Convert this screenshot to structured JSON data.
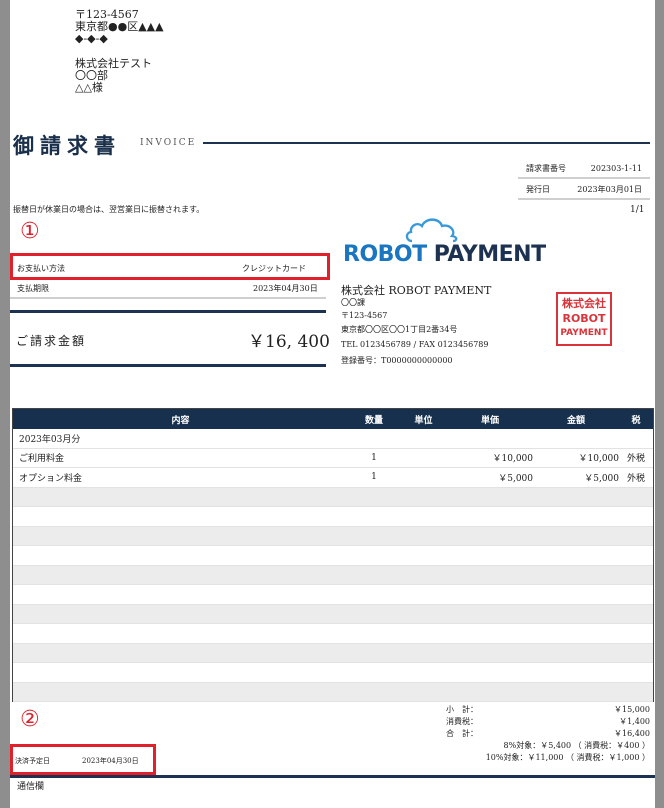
{
  "recipient": {
    "postal": "〒123-4567",
    "address1": "東京都●●区▲▲▲",
    "address2": "◆-◆-◆",
    "company": "株式会社テスト",
    "department": "〇〇部",
    "person": "△△様"
  },
  "header": {
    "title": "御請求書",
    "title_en": "INVOICE"
  },
  "meta": {
    "invoice_no_label": "請求書番号",
    "invoice_no": "202303-1-11",
    "issue_date_label": "発行日",
    "issue_date": "2023年03月01日",
    "page": "1/1"
  },
  "notice": "振替日が休業日の場合は、翌営業日に振替されます。",
  "annotations": {
    "marker1": "①",
    "marker2": "②"
  },
  "payment": {
    "method_label": "お支払い方法",
    "method_value": "クレジットカード",
    "due_label": "支払期限",
    "due_value": "2023年04月30日",
    "amount_label": "ご請求金額",
    "amount_value": "￥16, 400"
  },
  "issuer": {
    "logo_part1": "ROBOT ",
    "logo_part2": "PAYMENT",
    "company": "株式会社 ROBOT PAYMENT",
    "department": "〇〇課",
    "postal": "〒123-4567",
    "address": "東京都〇〇区〇〇1丁目2番34号",
    "tel_fax": "TEL 0123456789 / FAX 0123456789",
    "registration": "登録番号：T0000000000000",
    "seal_line1": "株式会社",
    "seal_line2": "ROBOT",
    "seal_line3": "PAYMENT"
  },
  "table": {
    "headers": {
      "item": "内容",
      "qty": "数量",
      "unit": "単位",
      "price": "単価",
      "amount": "金額",
      "tax": "税"
    },
    "rows": [
      {
        "item": "2023年03月分",
        "qty": "",
        "unit": "",
        "price": "",
        "amount": "",
        "tax": ""
      },
      {
        "item": "ご利用料金",
        "qty": "1",
        "unit": "",
        "price": "￥10,000",
        "amount": "￥10,000",
        "tax": "外税"
      },
      {
        "item": "オプション料金",
        "qty": "1",
        "unit": "",
        "price": "￥5,000",
        "amount": "￥5,000",
        "tax": "外税"
      },
      {
        "item": "",
        "qty": "",
        "unit": "",
        "price": "",
        "amount": "",
        "tax": ""
      },
      {
        "item": "",
        "qty": "",
        "unit": "",
        "price": "",
        "amount": "",
        "tax": ""
      },
      {
        "item": "",
        "qty": "",
        "unit": "",
        "price": "",
        "amount": "",
        "tax": ""
      },
      {
        "item": "",
        "qty": "",
        "unit": "",
        "price": "",
        "amount": "",
        "tax": ""
      },
      {
        "item": "",
        "qty": "",
        "unit": "",
        "price": "",
        "amount": "",
        "tax": ""
      },
      {
        "item": "",
        "qty": "",
        "unit": "",
        "price": "",
        "amount": "",
        "tax": ""
      },
      {
        "item": "",
        "qty": "",
        "unit": "",
        "price": "",
        "amount": "",
        "tax": ""
      },
      {
        "item": "",
        "qty": "",
        "unit": "",
        "price": "",
        "amount": "",
        "tax": ""
      },
      {
        "item": "",
        "qty": "",
        "unit": "",
        "price": "",
        "amount": "",
        "tax": ""
      },
      {
        "item": "",
        "qty": "",
        "unit": "",
        "price": "",
        "amount": "",
        "tax": ""
      },
      {
        "item": "",
        "qty": "",
        "unit": "",
        "price": "",
        "amount": "",
        "tax": ""
      }
    ]
  },
  "totals": {
    "subtotal_label": "小　計：",
    "subtotal": "￥15,000",
    "tax_label": "消費税：",
    "tax": "￥1,400",
    "total_label": "合　計：",
    "total": "￥16,400",
    "rate8": "8%対象：￥5,400 （ 消費税：￥400 ）",
    "rate10": "10%対象：￥11,000 （ 消費税：￥1,000 ）"
  },
  "settlement": {
    "label": "決済予定日",
    "date": "2023年04月30日"
  },
  "memo_label": "通信欄",
  "colors": {
    "navy": "#16304d",
    "red": "#e0202a",
    "logo_blue": "#1a76c0"
  }
}
